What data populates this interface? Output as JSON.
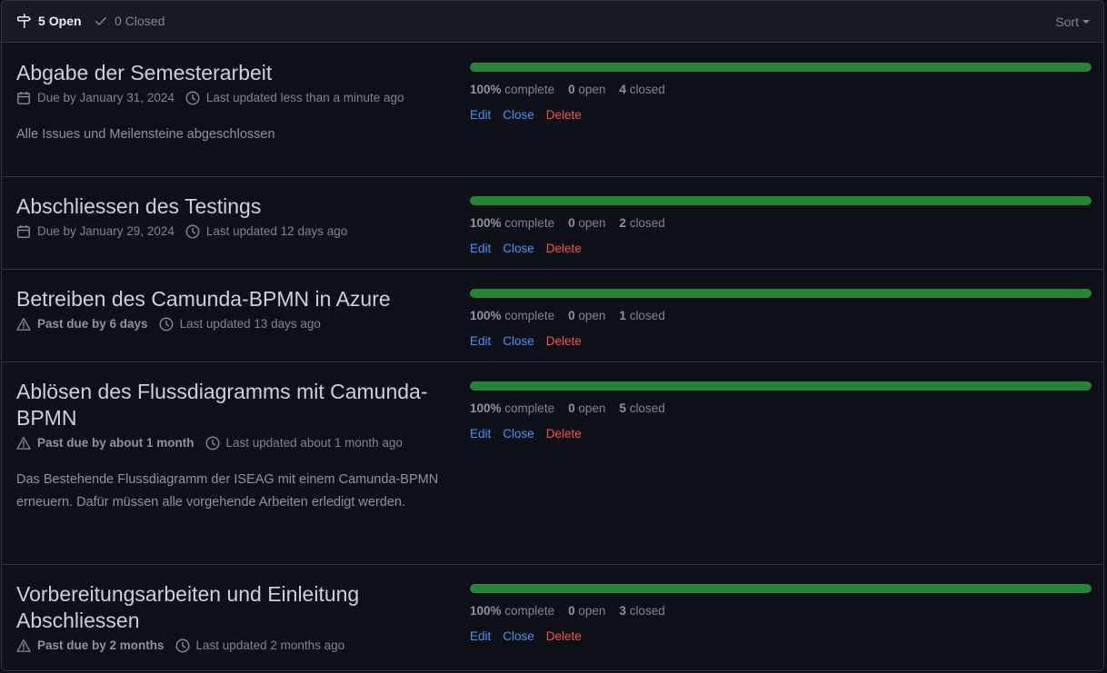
{
  "header": {
    "open_count": "5",
    "open_label": "Open",
    "closed_count": "0",
    "closed_label": "Closed",
    "sort_label": "Sort"
  },
  "colors": {
    "progress": "#238636",
    "link": "#4493f8",
    "delete": "#f85149"
  },
  "milestones": [
    {
      "title": "Abgabe der Semesterarbeit",
      "due_text": "Due by January 31, 2024",
      "updated": "Last updated less than a minute ago",
      "description": "Alle Issues und Meilensteine abgeschlossen",
      "progress": 100,
      "percent": "100%",
      "complete_label": "complete",
      "open": "0",
      "open_label": "open",
      "closed": "4",
      "closed_label": "closed",
      "actions": {
        "edit": "Edit",
        "close": "Close",
        "delete": "Delete"
      }
    },
    {
      "title": "Abschliessen des Testings",
      "due_text": "Due by January 29, 2024",
      "updated": "Last updated 12 days ago",
      "description": "",
      "progress": 100,
      "percent": "100%",
      "complete_label": "complete",
      "open": "0",
      "open_label": "open",
      "closed": "2",
      "closed_label": "closed",
      "actions": {
        "edit": "Edit",
        "close": "Close",
        "delete": "Delete"
      }
    },
    {
      "title": "Betreiben des Camunda-BPMN in Azure",
      "due_text": "Past due by 6 days",
      "updated": "Last updated 13 days ago",
      "description": "",
      "progress": 100,
      "percent": "100%",
      "complete_label": "complete",
      "open": "0",
      "open_label": "open",
      "closed": "1",
      "closed_label": "closed",
      "actions": {
        "edit": "Edit",
        "close": "Close",
        "delete": "Delete"
      }
    },
    {
      "title": "Ablösen des Flussdiagramms mit Camunda-BPMN",
      "due_text": "Past due by about 1 month",
      "updated": "Last updated about 1 month ago",
      "description": "Das Bestehende Flussdiagramm der ISEAG mit einem Camunda-BPMN erneuern. Dafür müssen alle vorgehende Arbeiten erledigt werden.",
      "progress": 100,
      "percent": "100%",
      "complete_label": "complete",
      "open": "0",
      "open_label": "open",
      "closed": "5",
      "closed_label": "closed",
      "actions": {
        "edit": "Edit",
        "close": "Close",
        "delete": "Delete"
      }
    },
    {
      "title": "Vorbereitungsarbeiten und Einleitung Abschliessen",
      "due_text": "Past due by 2 months",
      "updated": "Last updated 2 months ago",
      "description": "",
      "progress": 100,
      "percent": "100%",
      "complete_label": "complete",
      "open": "0",
      "open_label": "open",
      "closed": "3",
      "closed_label": "closed",
      "actions": {
        "edit": "Edit",
        "close": "Close",
        "delete": "Delete"
      }
    }
  ]
}
